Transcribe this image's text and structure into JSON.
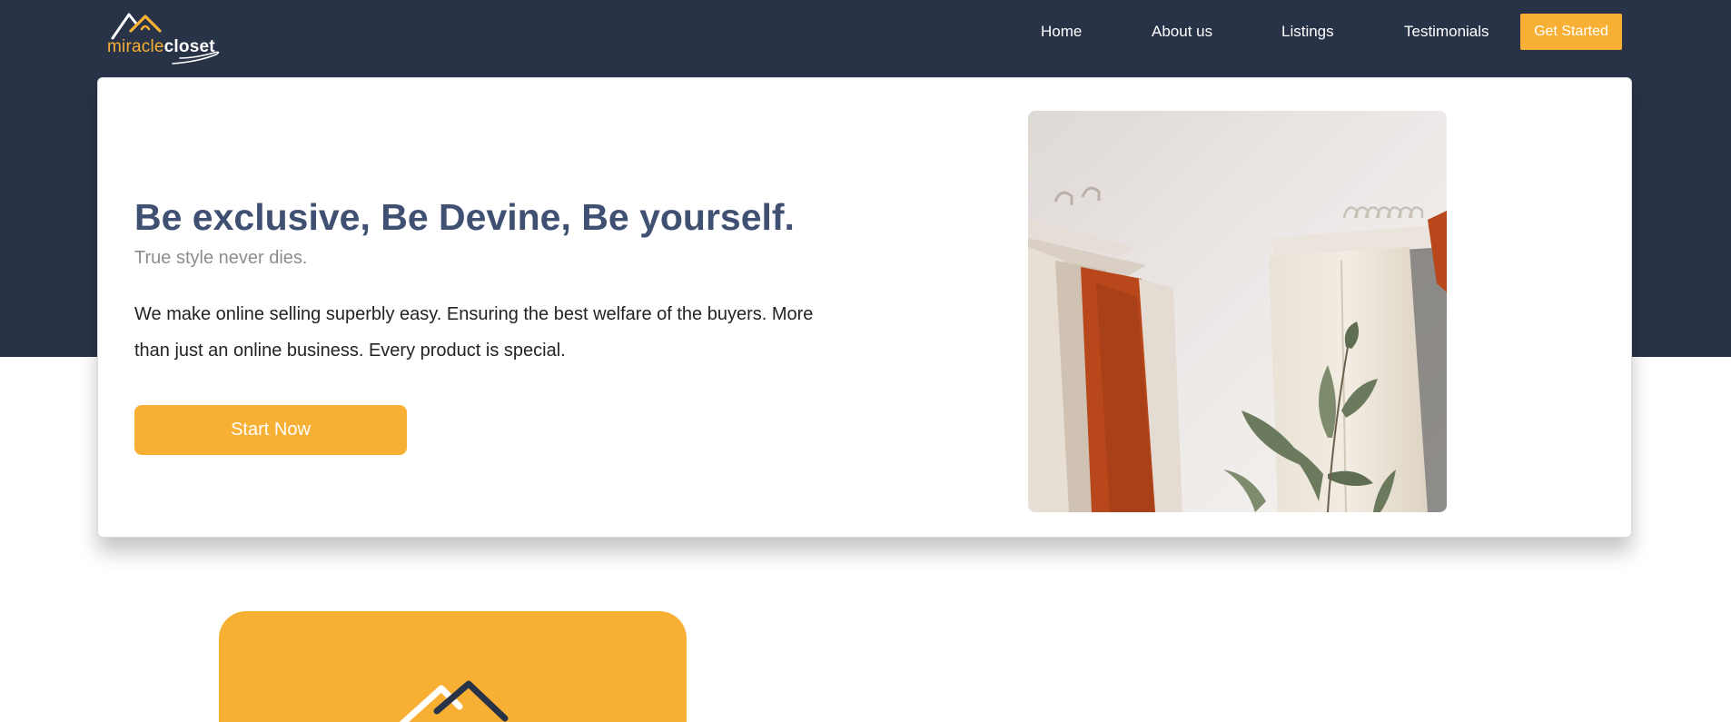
{
  "brand": {
    "logo_part1": "miracle",
    "logo_part2": "closet",
    "accent_color": "#f7b034",
    "header_color": "#283347"
  },
  "nav": {
    "items": [
      "Home",
      "About us",
      "Listings",
      "Testimonials"
    ],
    "cta_label": "Get Started"
  },
  "hero": {
    "title": "Be exclusive, Be Devine, Be yourself.",
    "subtitle": "True style never dies.",
    "description": "We make online selling superbly easy. Ensuring the best welfare of the buyers. More than just an online business. Every product is special.",
    "button_label": "Start Now",
    "image": "clothing-rack-photo"
  },
  "feature_card": {
    "icon": "house-logo-icon"
  }
}
